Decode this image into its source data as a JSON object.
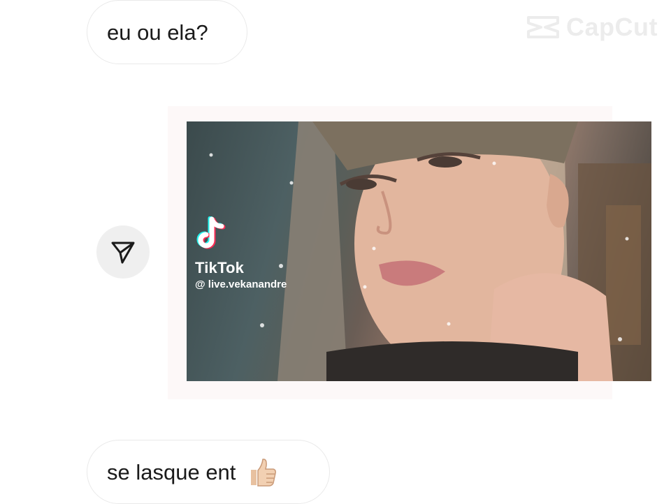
{
  "messages": [
    {
      "text": "eu ou ela?"
    },
    {
      "text": "se lasque ent",
      "emoji": "thumbs-up"
    }
  ],
  "watermark": {
    "text": "CapCut"
  },
  "shared_post": {
    "brand": "TikTok",
    "handle": "@ live.vekanandre"
  },
  "icons": {
    "share": "send-arrow-icon",
    "logo": "tiktok-note-icon",
    "reaction": "thumbs-up-emoji"
  }
}
